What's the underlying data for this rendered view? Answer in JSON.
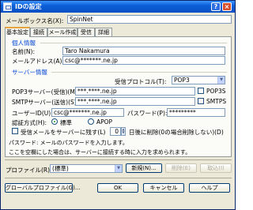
{
  "window": {
    "title": "IDの設定"
  },
  "mailbox": {
    "label": "メールボックス名(X):",
    "value": "SpinNet"
  },
  "tabs": [
    "基本設定",
    "接続",
    "メール作成",
    "受信",
    "詳細"
  ],
  "personal": {
    "group_title": "個人情報",
    "name_label": "名前(N):",
    "name_value": "Taro Nakamura",
    "email_label": "メールアドレス(A):",
    "email_value": "csc@*******.ne.jp"
  },
  "server": {
    "group_title": "サーバー情報",
    "protocol_label": "受信プロトコル(T):",
    "protocol_value": "POP3",
    "pop3_label": "POP3サーバー(受信)(M):",
    "pop3_value": "***.****.ne.jp",
    "pop3s_label": "POP3S",
    "smtp_label": "SMTPサーバー(送信)(S):",
    "smtp_value": "***.****.ne.jp",
    "smtps_label": "SMTPS",
    "user_label": "ユーザーID(U):",
    "user_value": "csc@*******.ne.jp",
    "password_label": "パスワード(P):",
    "password_value": "*********",
    "auth_label": "認証方式(H):",
    "auth_standard": "標準",
    "auth_apop": "APOP",
    "keep_label": "受信メールをサーバーに残す(L)",
    "keep_days": "0",
    "keep_after": "日後に削除(0の場合削除しない)(D)"
  },
  "help": {
    "line1": "パスワード: メールのパスワードを入力します。",
    "line2": "ここを空欄にした場合は、サーバーに接続する時に入力を求められます。"
  },
  "profile": {
    "label": "プロファイル(R):",
    "value": "(標準)",
    "new_button": "新規(N)...",
    "delete_button": "削除(E)",
    "import_button": "取込(I)"
  },
  "footer": {
    "global_button": "グローバルプロファイル(G)...",
    "ok_button": "OK",
    "cancel_button": "キャンセル",
    "help_button": "ヘルプ"
  }
}
